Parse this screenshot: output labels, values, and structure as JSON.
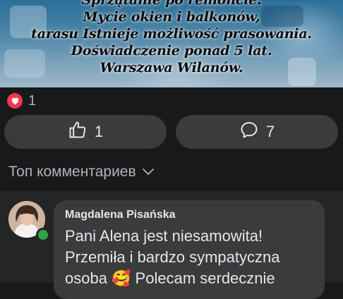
{
  "post": {
    "image_text": [
      "Sprzątanie po remoncie.",
      "Mycie okien i balkonów,",
      "tarasu Istnieje możliwość prasowania.",
      "Doświadczenie ponad 5 lat.",
      "Warszawa Wilanów."
    ]
  },
  "reactions": {
    "icon": "heart-icon",
    "count": "1"
  },
  "actions": {
    "like_icon": "thumbs-up-icon",
    "like_count": "1",
    "comment_icon": "comment-bubble-icon",
    "comment_count": "7"
  },
  "comments_sort": {
    "label": "Топ комментариев",
    "icon": "chevron-down-icon"
  },
  "comments": [
    {
      "author": "Magdalena Pisańska",
      "online": true,
      "text_lines": [
        "Pani Alena jest niesamowita!",
        "Przemiła i bardzo sympatyczna",
        "osoba 🥰 Polecam serdecznie"
      ]
    }
  ],
  "colors": {
    "background": "#18191a",
    "button": "#3a3b3c",
    "text": "#e4e6eb",
    "muted": "#b0b3b8",
    "heart": "#f0384f",
    "online": "#31a24c"
  }
}
